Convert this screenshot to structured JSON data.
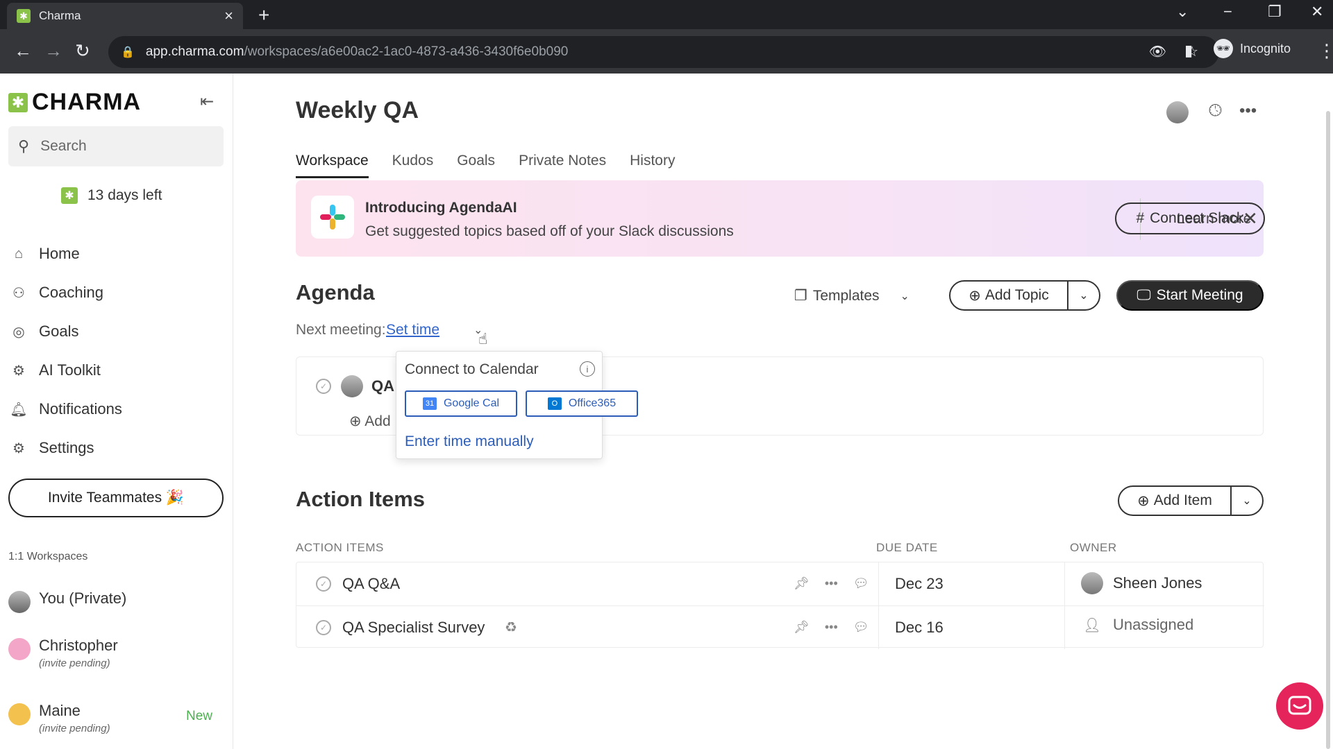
{
  "browser": {
    "tab_title": "Charma",
    "url_host": "app.charma.com",
    "url_path": "/workspaces/a6e00ac2-1ac0-4873-a436-3430f6e0b090",
    "incognito_label": "Incognito"
  },
  "sidebar": {
    "logo_text": "CHARMA",
    "search_placeholder": "Search",
    "trial_text": "13 days left",
    "nav": [
      {
        "label": "Home",
        "icon": "home-icon"
      },
      {
        "label": "Coaching",
        "icon": "coaching-icon"
      },
      {
        "label": "Goals",
        "icon": "goals-icon"
      },
      {
        "label": "AI Toolkit",
        "icon": "ai-toolkit-icon"
      },
      {
        "label": "Notifications",
        "icon": "bell-icon"
      },
      {
        "label": "Settings",
        "icon": "gear-icon"
      }
    ],
    "invite_label": "Invite Teammates 🎉",
    "workspaces_title": "1:1 Workspaces",
    "workspaces": [
      {
        "name": "You (Private)",
        "sub": ""
      },
      {
        "name": "Christopher",
        "sub": "(invite pending)"
      },
      {
        "name": "Maine",
        "sub": "(invite pending)",
        "badge": "New"
      }
    ]
  },
  "header": {
    "title": "Weekly QA",
    "tabs": [
      "Workspace",
      "Kudos",
      "Goals",
      "Private Notes",
      "History"
    ],
    "active_tab": "Workspace"
  },
  "banner": {
    "title": "Introducing AgendaAI",
    "subtitle": "Get suggested topics based off of your Slack discussions",
    "learn_more": "Learn more",
    "connect_slack": "Connect Slack"
  },
  "agenda": {
    "title": "Agenda",
    "templates_label": "Templates",
    "add_topic_label": "Add Topic",
    "start_meeting_label": "Start Meeting",
    "next_meeting_label": "Next meeting:",
    "set_time_label": "Set time",
    "topic": "QA",
    "add_label": "Add"
  },
  "calendar_popover": {
    "title": "Connect to Calendar",
    "google_label": "Google Cal",
    "office_label": "Office365",
    "enter_manually": "Enter time manually"
  },
  "action_items": {
    "title": "Action Items",
    "add_item_label": "Add Item",
    "columns": [
      "ACTION ITEMS",
      "DUE DATE",
      "OWNER"
    ],
    "rows": [
      {
        "name": "QA Q&A",
        "due": "Dec 23",
        "owner": "Sheen Jones",
        "recurring": false
      },
      {
        "name": "QA Specialist Survey",
        "due": "Dec 16",
        "owner": "Unassigned",
        "recurring": true
      }
    ]
  },
  "colors": {
    "brand_green": "#8bc34a",
    "link_blue": "#2b5db8",
    "chat_fab": "#e4245b"
  }
}
